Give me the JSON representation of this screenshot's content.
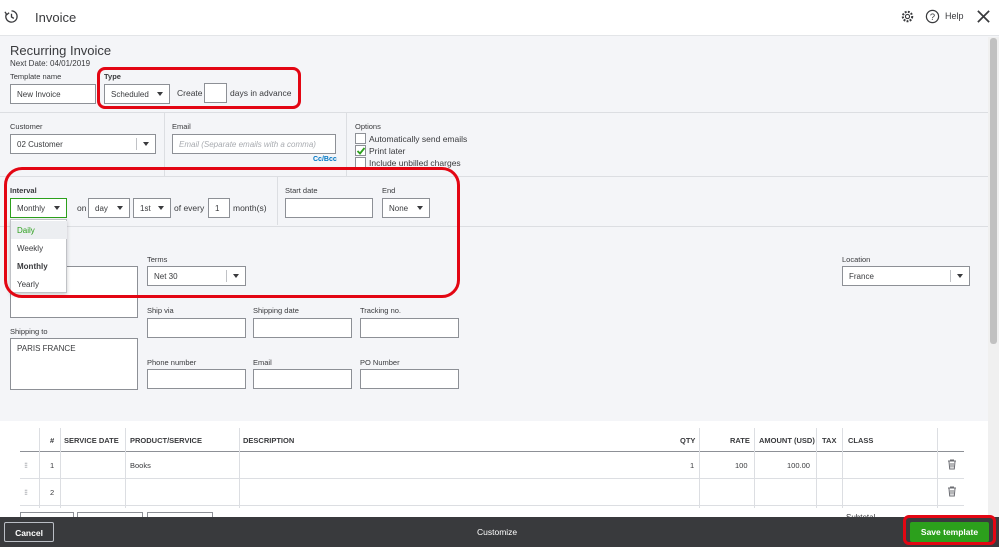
{
  "header": {
    "title": "Invoice",
    "help": "Help"
  },
  "form": {
    "heading": "Recurring Invoice",
    "next_date": "Next Date: 04/01/2019",
    "template_name_label": "Template name",
    "template_name_value": "New Invoice",
    "type_label": "Type",
    "type_value": "Scheduled",
    "create_label": "Create",
    "days_advance_label": "days in advance",
    "customer_label": "Customer",
    "customer_value": "02 Customer",
    "email_label": "Email",
    "email_placeholder": "Email (Separate emails with a comma)",
    "ccbcc": "Cc/Bcc",
    "options_label": "Options",
    "options": [
      {
        "label": "Automatically send emails",
        "checked": false
      },
      {
        "label": "Print later",
        "checked": true
      },
      {
        "label": "Include unbilled charges",
        "checked": false
      }
    ],
    "interval_label": "Interval",
    "interval_value": "Monthly",
    "interval_options": [
      "Daily",
      "Weekly",
      "Monthly",
      "Yearly"
    ],
    "on_label": "on",
    "on_value": "day",
    "day_value": "1st",
    "of_every_label": "of every",
    "every_value": "1",
    "months_label": "month(s)",
    "start_date_label": "Start date",
    "end_label": "End",
    "end_value": "None",
    "terms_label": "Terms",
    "terms_value": "Net 30",
    "location_label": "Location",
    "location_value": "France",
    "ship_via_label": "Ship via",
    "shipping_date_label": "Shipping date",
    "tracking_label": "Tracking no.",
    "shipping_to_label": "Shipping to",
    "shipping_to_value": "PARIS FRANCE",
    "phone_label": "Phone number",
    "email2_label": "Email",
    "po_label": "PO Number"
  },
  "table": {
    "headers": [
      "#",
      "SERVICE DATE",
      "PRODUCT/SERVICE",
      "DESCRIPTION",
      "QTY",
      "RATE",
      "AMOUNT (USD)",
      "TAX",
      "CLASS"
    ],
    "rows": [
      {
        "num": "1",
        "product": "Books",
        "qty": "1",
        "rate": "100",
        "amount": "100.00"
      },
      {
        "num": "2",
        "product": "",
        "qty": "",
        "rate": "",
        "amount": ""
      }
    ],
    "subtotal_label": "Subtotal"
  },
  "footer": {
    "cancel": "Cancel",
    "customize": "Customize",
    "save": "Save template"
  },
  "colors": {
    "accent": "#2ca01c",
    "highlight": "#e30613",
    "footer_bg": "#393a3d"
  }
}
